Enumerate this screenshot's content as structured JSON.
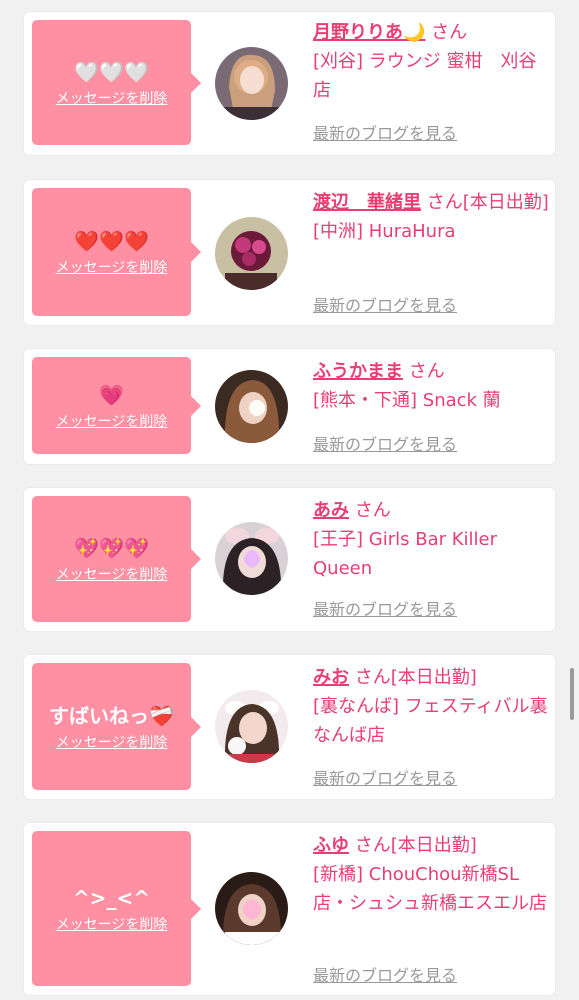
{
  "delete_label": "メッセージを削除",
  "blog_label": "最新のブログを見る",
  "entries": [
    {
      "message": "🤍🤍🤍",
      "name": "月野りりあ🌙",
      "suffix": "さん",
      "location": "[刈谷] ラウンジ 蜜柑　刈谷店"
    },
    {
      "message": "❤️❤️❤️",
      "name": "渡辺　華緒里",
      "suffix": "さん[本日出勤]",
      "location": "[中洲] HuraHura"
    },
    {
      "message": "💗",
      "name": "ふうかまま",
      "suffix": "さん",
      "location": "[熊本・下通] Snack 蘭"
    },
    {
      "message": "💖💖💖",
      "name": "あみ",
      "suffix": "さん",
      "location": "[王子] Girls Bar Killer Queen"
    },
    {
      "message": "すばいねっ❤️‍🩹",
      "name": "みお",
      "suffix": "さん[本日出勤]",
      "location": "[裏なんば] フェスティバル裏なんば店"
    },
    {
      "message": "^>_<^",
      "name": "ふゆ",
      "suffix": "さん[本日出勤]",
      "location": "[新橋] ChouChou新橋SL店・シュシュ新橋エスエル店"
    }
  ],
  "colors": {
    "accent": "#e83e73",
    "bubble": "#ff8fa3",
    "muted": "#999999",
    "background": "#f1f1f1"
  }
}
